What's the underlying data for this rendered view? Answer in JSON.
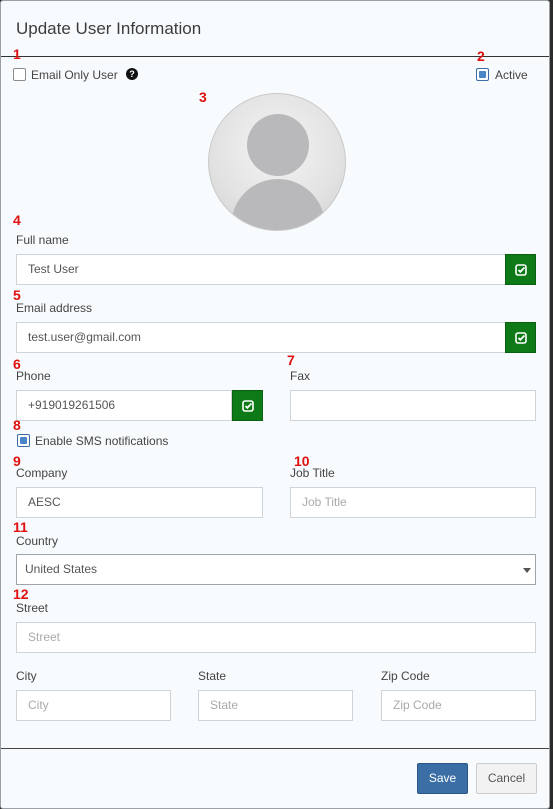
{
  "dialog": {
    "title": "Update User Information"
  },
  "markers": [
    "1",
    "2",
    "3",
    "4",
    "5",
    "6",
    "7",
    "8",
    "9",
    "10",
    "11",
    "12"
  ],
  "email_only": {
    "label": "Email Only User",
    "checked": false,
    "help_icon": "question-circle-icon"
  },
  "active": {
    "label": "Active",
    "checked": true
  },
  "avatar": {
    "icon": "user-placeholder-icon"
  },
  "full_name": {
    "label": "Full name",
    "value": "Test User",
    "verify_icon": "check-square-icon"
  },
  "email": {
    "label": "Email address",
    "value": "test.user@gmail.com",
    "verify_icon": "check-square-icon"
  },
  "phone": {
    "label": "Phone",
    "value": "+919019261506",
    "verify_icon": "check-square-icon"
  },
  "fax": {
    "label": "Fax",
    "value": ""
  },
  "sms": {
    "label": "Enable SMS notifications",
    "checked": true
  },
  "company": {
    "label": "Company",
    "value": "AESC"
  },
  "job_title": {
    "label": "Job Title",
    "placeholder": "Job Title"
  },
  "country": {
    "label": "Country",
    "value": "United States"
  },
  "street": {
    "label": "Street",
    "placeholder": "Street"
  },
  "city": {
    "label": "City",
    "placeholder": "City"
  },
  "state": {
    "label": "State",
    "placeholder": "State"
  },
  "zip": {
    "label": "Zip Code",
    "placeholder": "Zip Code"
  },
  "footer": {
    "save_label": "Save",
    "cancel_label": "Cancel"
  },
  "colors": {
    "verify_green": "#0e7a17",
    "primary_blue": "#3a6ea5",
    "marker_red": "#e01010"
  }
}
